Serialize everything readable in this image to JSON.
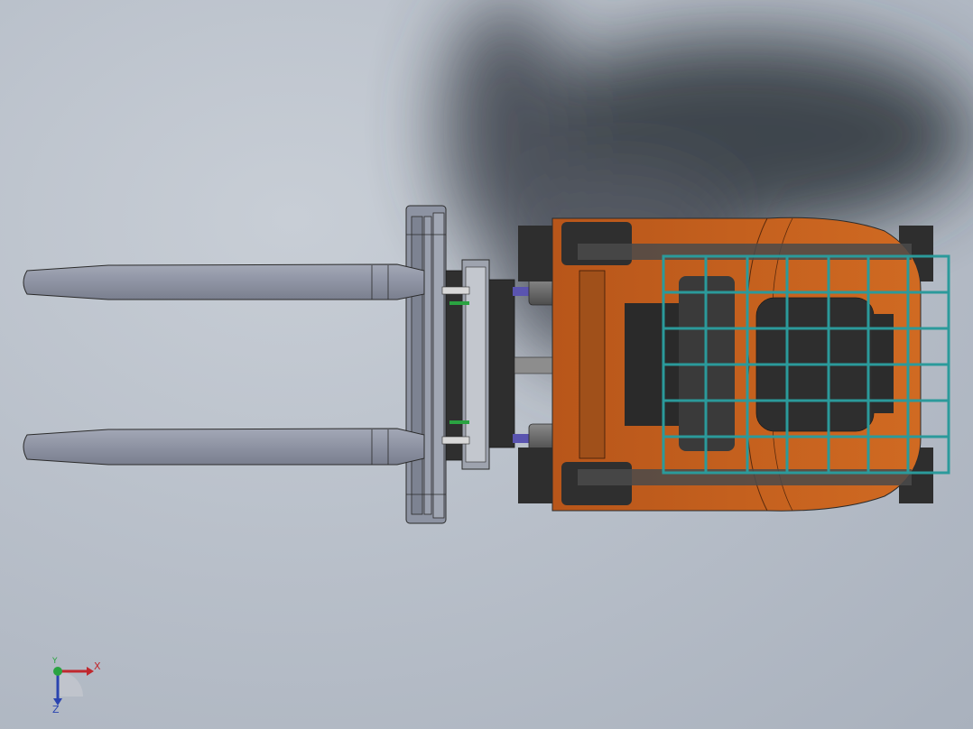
{
  "viewport": {
    "background": "#b9c0ca",
    "shadow": "#2f343d"
  },
  "model": {
    "body_color": "#c8651e",
    "cage_color": "#2b9a9b",
    "fork_color": "#8e93a3",
    "dark_part": "#3a3a3a",
    "cylinder_color": "#6b6b6b",
    "hose_color": "#5a54b0",
    "accent_green": "#2aa341"
  },
  "triad": {
    "x_label": "X",
    "y_label": "Y",
    "z_label": "Z",
    "x_color": "#c0272d",
    "y_color": "#2aa341",
    "z_color": "#2a44b0"
  }
}
